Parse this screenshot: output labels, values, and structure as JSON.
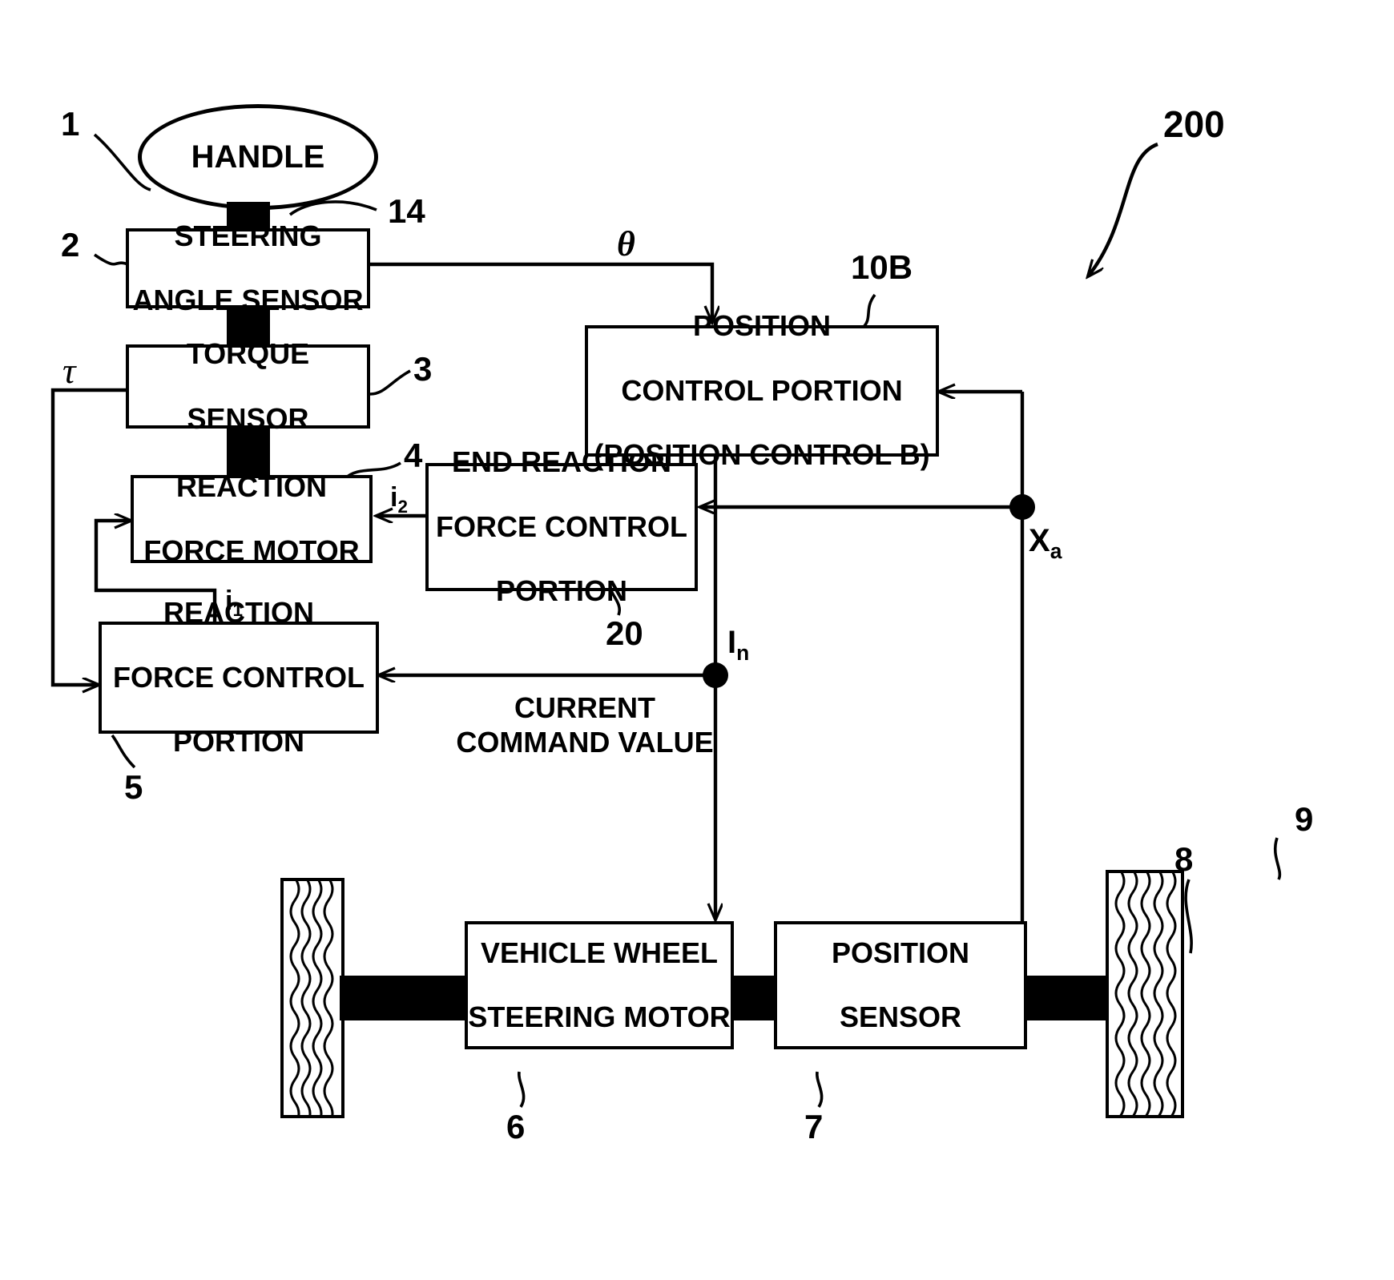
{
  "figure": {
    "system_ref": "200",
    "blocks": {
      "handle": {
        "label": "HANDLE",
        "ref": "1"
      },
      "steering_angle_sensor": {
        "line1": "STEERING",
        "line2": "ANGLE SENSOR",
        "ref": "2"
      },
      "torque_sensor": {
        "line1": "TORQUE",
        "line2": "SENSOR",
        "ref": "3"
      },
      "reaction_force_motor": {
        "line1": "REACTION",
        "line2": "FORCE MOTOR",
        "ref": "4"
      },
      "reaction_force_control_portion": {
        "line1": "REACTION",
        "line2": "FORCE CONTROL",
        "line3": "PORTION",
        "ref": "5"
      },
      "end_reaction_force_control_portion": {
        "line1": "END REACTION",
        "line2": "FORCE CONTROL",
        "line3": "PORTION",
        "ref": "20"
      },
      "position_control_portion": {
        "line1": "POSITION",
        "line2": "CONTROL PORTION",
        "line3": "(POSITION CONTROL B)",
        "ref": "10B"
      },
      "vehicle_wheel_steering_motor": {
        "line1": "VEHICLE WHEEL",
        "line2": "STEERING MOTOR",
        "ref": "6"
      },
      "position_sensor": {
        "line1": "POSITION",
        "line2": "SENSOR",
        "ref": "7"
      },
      "column_shaft": {
        "ref": "14"
      },
      "tie_rod": {
        "ref": "8"
      },
      "right_wheel": {
        "ref": "9"
      }
    },
    "signals": {
      "theta": "θ",
      "tau": "τ",
      "i1_base": "i",
      "i1_sub": "1",
      "i2_base": "i",
      "i2_sub": "2",
      "in_base": "I",
      "in_sub": "n",
      "xa_base": "X",
      "xa_sub": "a",
      "current_command_value_line1": "CURRENT",
      "current_command_value_line2": "COMMAND VALUE"
    },
    "colors": {
      "ink": "#000000",
      "paper": "#ffffff"
    }
  }
}
